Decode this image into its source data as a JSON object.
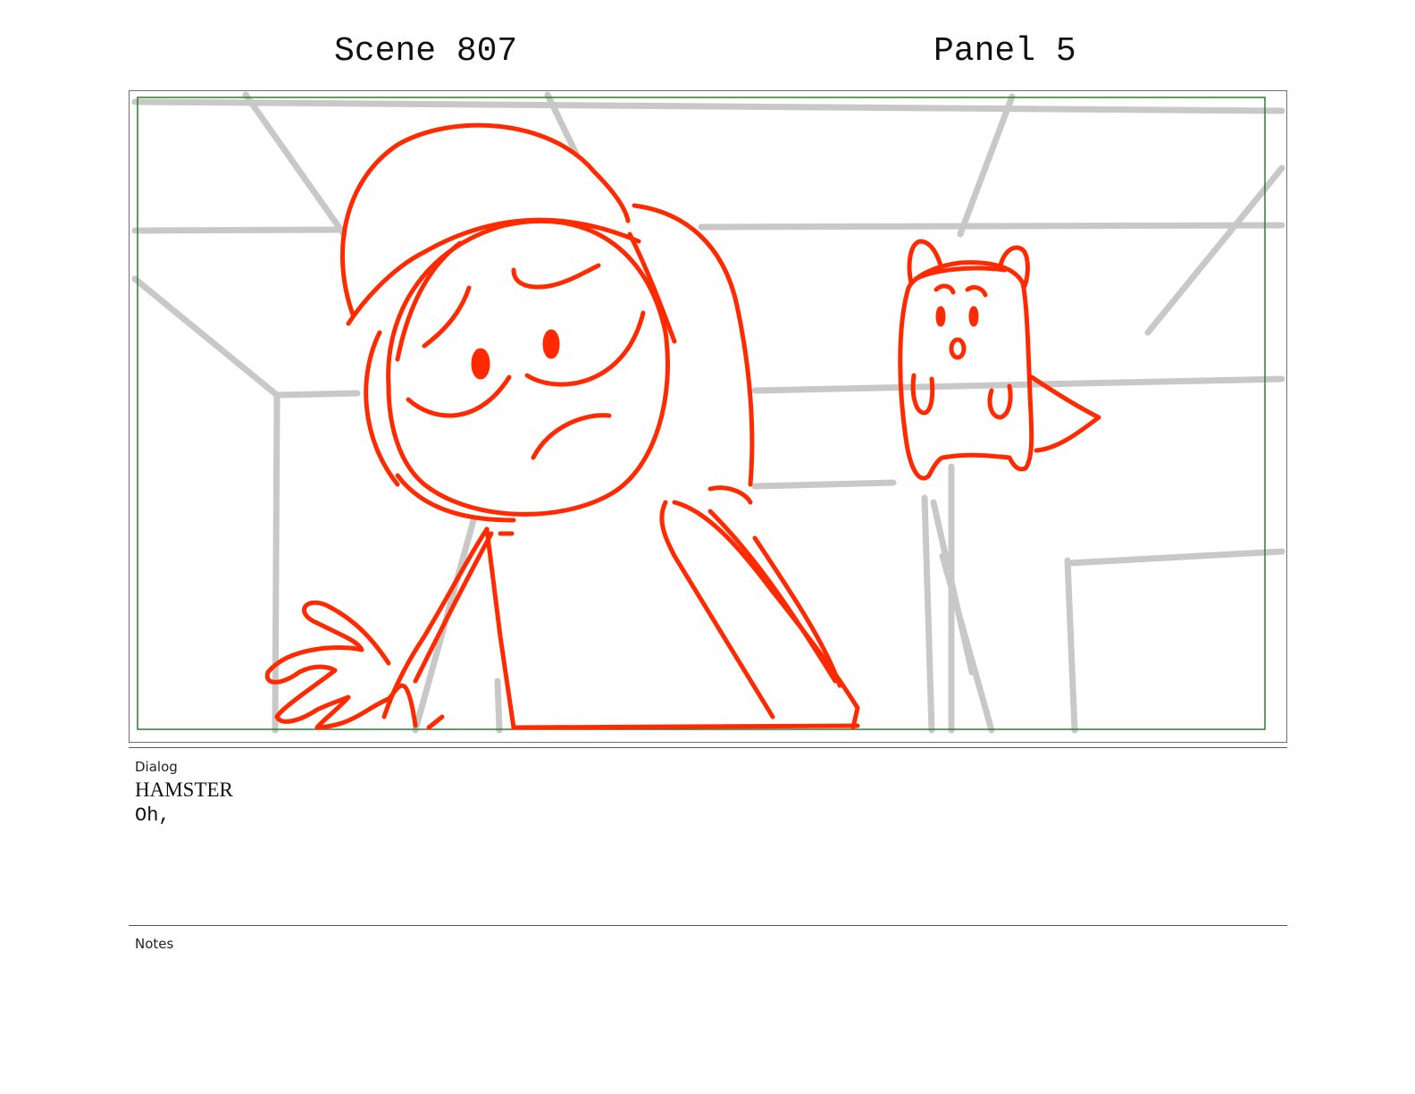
{
  "header": {
    "scene_label": "Scene 807",
    "panel_label": "Panel 5"
  },
  "sections": {
    "dialog_label": "Dialog",
    "notes_label": "Notes"
  },
  "dialog": {
    "character": "HAMSTER",
    "line": "Oh,"
  },
  "notes": {
    "text": ""
  },
  "colors": {
    "sketch_red": "#ff2a00",
    "background_lines": "#c8c8c8",
    "safe_area_green": "#2e7d32",
    "frame_border": "#6e6e6e"
  }
}
